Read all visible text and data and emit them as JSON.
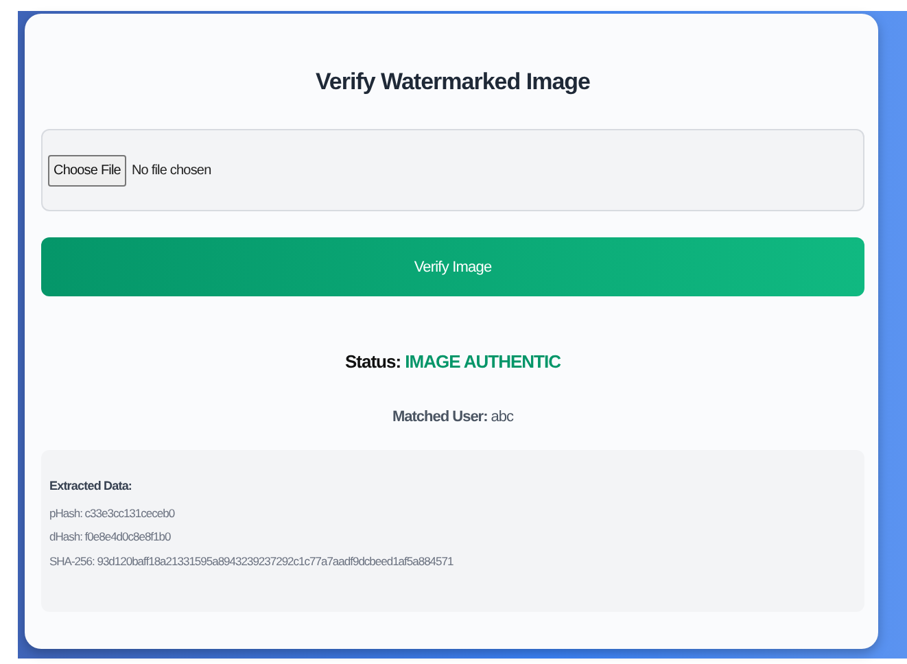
{
  "title": "Verify Watermarked Image",
  "file_picker": {
    "button": "Choose File",
    "value": "No file chosen"
  },
  "verify_button": "Verify Image",
  "status": {
    "label": "Status:",
    "value": "IMAGE AUTHENTIC"
  },
  "matched_user": {
    "label": "Matched User:",
    "value": "abc"
  },
  "extracted": {
    "heading": "Extracted Data:",
    "lines": [
      "pHash: c33e3cc131ceceb0",
      "dHash: f0e8e4d0c8e8f1b0",
      "SHA-256: 93d120baff18a21331595a8943239237292c1c77a7aadf9dcbeed1af5a884571"
    ]
  }
}
